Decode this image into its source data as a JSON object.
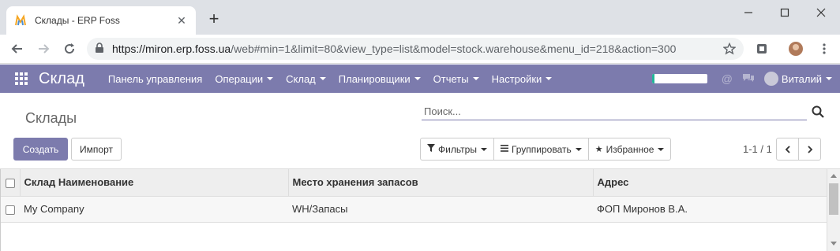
{
  "browser": {
    "tab_title": "Склады - ERP Foss",
    "url_host": "https://miron.erp.foss.ua",
    "url_path": "/web#min=1&limit=80&view_type=list&model=stock.warehouse&menu_id=218&action=300"
  },
  "navbar": {
    "brand": "Склад",
    "menu": [
      "Панель управления",
      "Операции",
      "Склад",
      "Планировщики",
      "Отчеты",
      "Настройки"
    ],
    "user": "Виталий",
    "progress_percent": 5,
    "accent_color": "#7c7bad"
  },
  "control_panel": {
    "breadcrumb": "Склады",
    "search_placeholder": "Поиск...",
    "create_label": "Создать",
    "import_label": "Импорт",
    "filters_label": "Фильтры",
    "group_label": "Группировать",
    "favorites_label": "Избранное",
    "pager": "1-1 / 1"
  },
  "table": {
    "columns": [
      "Склад Наименование",
      "Место хранения запасов",
      "Адрес"
    ],
    "rows": [
      [
        "My Company",
        "WH/Запасы",
        "ФОП Миронов В.А."
      ]
    ]
  }
}
